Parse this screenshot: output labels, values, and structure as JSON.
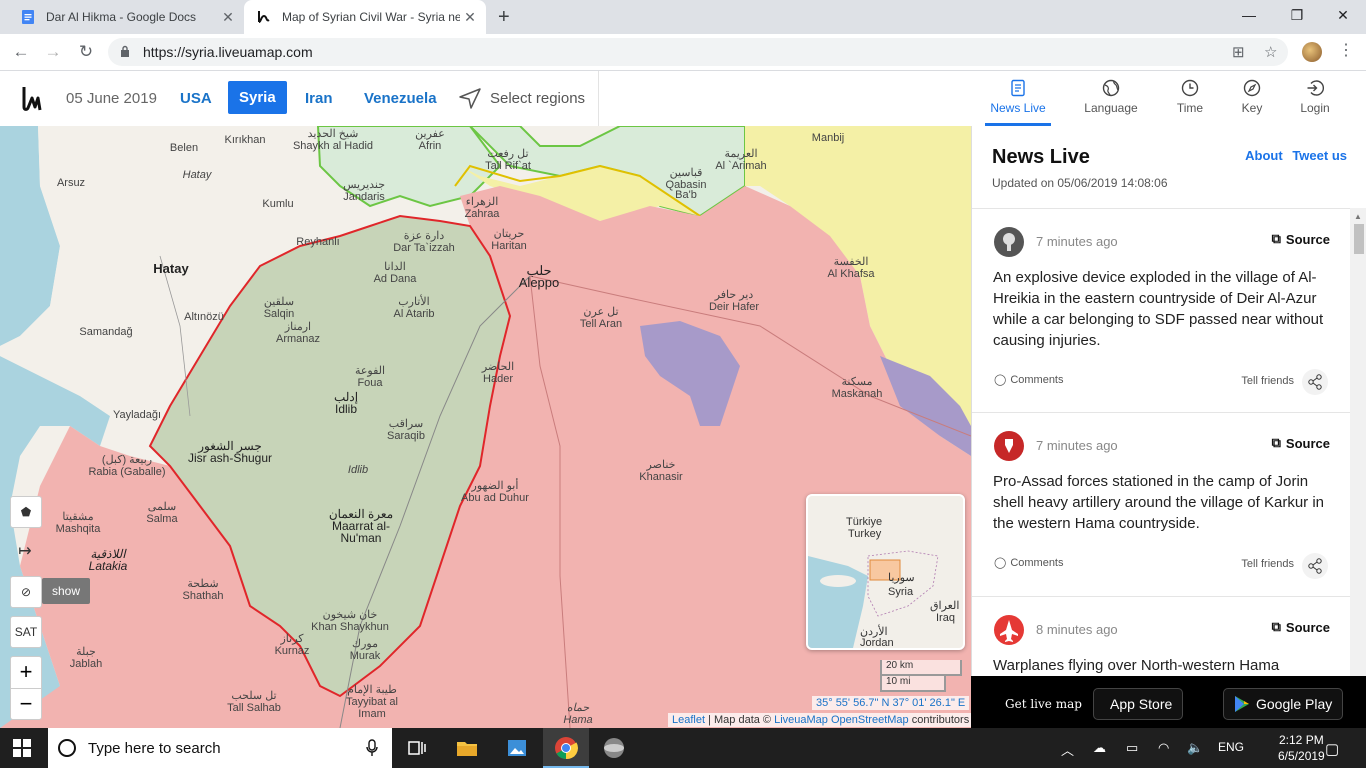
{
  "browser": {
    "tabs": [
      {
        "title": "Dar Al Hikma - Google Docs",
        "active": false
      },
      {
        "title": "Map of Syrian Civil War - Syria ne",
        "active": true
      }
    ],
    "url": "https://syria.liveuamap.com"
  },
  "header": {
    "date": "05 June 2019",
    "regions": [
      "USA",
      "Syria",
      "Iran",
      "Venezuela"
    ],
    "active_region": "Syria",
    "select_regions": "Select regions",
    "nav": [
      {
        "label": "News Live",
        "icon": "news-icon",
        "active": true
      },
      {
        "label": "Language",
        "icon": "globe-icon",
        "active": false
      },
      {
        "label": "Time",
        "icon": "clock-icon",
        "active": false
      },
      {
        "label": "Key",
        "icon": "compass-icon",
        "active": false
      },
      {
        "label": "Login",
        "icon": "login-icon",
        "active": false
      }
    ]
  },
  "map": {
    "place_labels": [
      {
        "text": "Kırıkhan",
        "ar": ""
      },
      {
        "text": "Belen",
        "ar": ""
      },
      {
        "text": "Hatay",
        "ar": ""
      },
      {
        "text": "Arsuz",
        "ar": ""
      },
      {
        "text": "Kumlu",
        "ar": ""
      },
      {
        "text": "Reyhanlı",
        "ar": ""
      },
      {
        "text": "Hatay",
        "ar": ""
      },
      {
        "text": "Altınözü",
        "ar": ""
      },
      {
        "text": "Samandağ",
        "ar": ""
      },
      {
        "text": "Yayladağı",
        "ar": ""
      },
      {
        "text": "Shaykh al Hadid",
        "ar": "شيخ الحديد"
      },
      {
        "text": "Afrin",
        "ar": "عفرين"
      },
      {
        "text": "Jandaris",
        "ar": "جنديريس"
      },
      {
        "text": "Tall Rif`at",
        "ar": "تل رفعت"
      },
      {
        "text": "Zahraa",
        "ar": "الزهراء"
      },
      {
        "text": "Haritan",
        "ar": "حريتان"
      },
      {
        "text": "Dar Ta`izzah",
        "ar": "دارة عزة"
      },
      {
        "text": "Ad Dana",
        "ar": "الدانا"
      },
      {
        "text": "Al Atarib",
        "ar": "الأتارب"
      },
      {
        "text": "Aleppo",
        "ar": "حلب"
      },
      {
        "text": "Tell Aran",
        "ar": "تل عرن"
      },
      {
        "text": "Deir Hafer",
        "ar": "دير حافر"
      },
      {
        "text": "Qabasin",
        "ar": "قباسين"
      },
      {
        "text": "Ba'b",
        "ar": "الباب"
      },
      {
        "text": "Al `Arimah",
        "ar": "العريمة"
      },
      {
        "text": "Manbij",
        "ar": ""
      },
      {
        "text": "Al Khafsa",
        "ar": "الخفسة"
      },
      {
        "text": "Maskanah",
        "ar": "مسكنة"
      },
      {
        "text": "Salqin",
        "ar": "سلقين"
      },
      {
        "text": "Armanaz",
        "ar": "ارمناز"
      },
      {
        "text": "Foua",
        "ar": "الفوعة"
      },
      {
        "text": "Idlib",
        "ar": "إدلب"
      },
      {
        "text": "Hader",
        "ar": "الحاضر"
      },
      {
        "text": "Saraqib",
        "ar": "سراقب"
      },
      {
        "text": "Idlib",
        "ar": ""
      },
      {
        "text": "Jisr ash-Shugur",
        "ar": "جسر الشغور"
      },
      {
        "text": "Rabia (Gaballe)",
        "ar": "ربيعة (كبل)"
      },
      {
        "text": "Khanasir",
        "ar": "خناصر"
      },
      {
        "text": "Abu ad Duhur",
        "ar": "أبو الضهور"
      },
      {
        "text": "Maarrat al-Nu'man",
        "ar": "معرة النعمان"
      },
      {
        "text": "Salma",
        "ar": "سلمى"
      },
      {
        "text": "Mashqita",
        "ar": "مشقيتا"
      },
      {
        "text": "Latakia",
        "ar": "اللاذقية"
      },
      {
        "text": "Shathah",
        "ar": "شطحة"
      },
      {
        "text": "Khan Shaykhun",
        "ar": "خان شيخون"
      },
      {
        "text": "Kurnaz",
        "ar": "كرناز"
      },
      {
        "text": "Murak",
        "ar": "مورك"
      },
      {
        "text": "Jablah",
        "ar": "جبلة"
      },
      {
        "text": "Tall Salhab",
        "ar": "تل سلحب"
      },
      {
        "text": "Tayyibat al Imam",
        "ar": "طيبة الإمام"
      },
      {
        "text": "Hama",
        "ar": "حماه"
      }
    ],
    "controls": {
      "show_tip": "show",
      "sat": "SAT",
      "zoom_in": "+",
      "zoom_out": "−"
    },
    "minimap_labels": [
      "Türkiye",
      "Turkey",
      "سوريا",
      "Syria",
      "العراق",
      "Iraq",
      "الأردن",
      "Jordan"
    ],
    "scale": [
      "20 km",
      "10 mi"
    ],
    "coords": "35° 55' 56.7\" N 37° 01' 26.1\" E",
    "attribution": {
      "leaflet": "Leaflet",
      "mapdata": "Map data ©",
      "liveuamap": "LiveuaMap",
      "osm": "OpenStreetMap",
      "contributors": "contributors"
    }
  },
  "news": {
    "title": "News Live",
    "updated": "Updated on 05/06/2019 14:08:06",
    "about": "About",
    "tweet": "Tweet us",
    "items": [
      {
        "time": "7 minutes ago",
        "source": "Source",
        "text": "An explosive device exploded in the village of Al-Hreikia in the eastern countryside of Deir Al-Azur while a car belonging to SDF passed near without causing injuries.",
        "comments": "Comments",
        "tell": "Tell friends",
        "icon": "explosion-icon"
      },
      {
        "time": "7 minutes ago",
        "source": "Source",
        "text": "Pro-Assad forces stationed in the camp of Jorin shell heavy artillery around the village of Karkur in the western Hama countryside.",
        "comments": "Comments",
        "tell": "Tell friends",
        "icon": "artillery-icon"
      },
      {
        "time": "8 minutes ago",
        "source": "Source",
        "text": "Warplanes flying over North-western Hama",
        "comments": "",
        "tell": "",
        "icon": "airplane-icon"
      }
    ]
  },
  "appbar": {
    "get_live": "Get live map",
    "app_store": "App Store",
    "google_play": "Google Play"
  },
  "taskbar": {
    "search_placeholder": "Type here to search",
    "lang": "ENG",
    "time": "2:12 PM",
    "date": "6/5/2019"
  },
  "colors": {
    "regime": "#f2b3b0",
    "rebel": "#c7d4b8",
    "sdf": "#f4f0a6",
    "turkey_backed": "#d9ebd9",
    "isis": "#a79ac9",
    "accent": "#1a73e8"
  }
}
